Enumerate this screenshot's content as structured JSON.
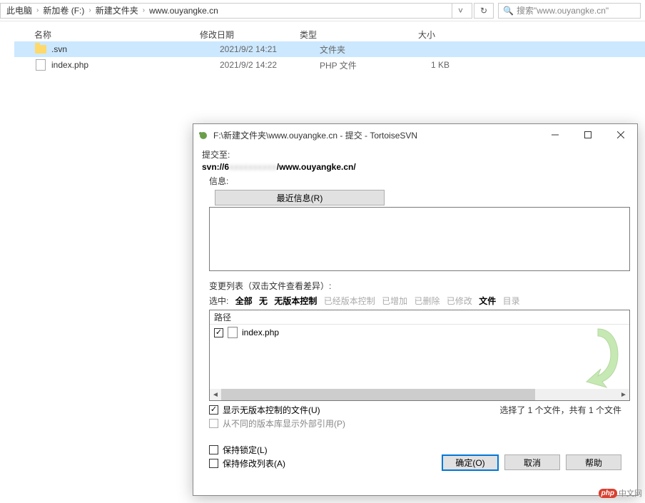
{
  "breadcrumb": {
    "items": [
      "此电脑",
      "新加卷 (F:)",
      "新建文件夹",
      "www.ouyangke.cn"
    ]
  },
  "search": {
    "placeholder": "搜索\"www.ouyangke.cn\""
  },
  "columns": {
    "name": "名称",
    "date": "修改日期",
    "type": "类型",
    "size": "大小"
  },
  "files": [
    {
      "name": ".svn",
      "date": "2021/9/2 14:21",
      "type": "文件夹",
      "size": "",
      "kind": "folder",
      "selected": true
    },
    {
      "name": "index.php",
      "date": "2021/9/2 14:22",
      "type": "PHP 文件",
      "size": "1 KB",
      "kind": "php",
      "selected": false
    }
  ],
  "dialog": {
    "title": "F:\\新建文件夹\\www.ouyangke.cn - 提交 - TortoiseSVN",
    "commit_to_label": "提交至:",
    "svn_prefix": "svn://6",
    "svn_suffix": "/www.ouyangke.cn/",
    "info_label": "信息:",
    "recent_btn": "最近信息(R)",
    "changes_label": "变更列表（双击文件查看差异）:",
    "filters": {
      "label": "选中:",
      "all": "全部",
      "none": "无",
      "unversioned": "无版本控制",
      "versioned": "已经版本控制",
      "added": "已增加",
      "deleted": "已删除",
      "modified": "已修改",
      "files": "文件",
      "dirs": "目录"
    },
    "path_header": "路径",
    "change_items": [
      {
        "name": "index.php",
        "checked": true
      }
    ],
    "show_unversioned": "显示无版本控制的文件(U)",
    "show_externals": "从不同的版本库显示外部引用(P)",
    "selection_status": "选择了 1 个文件，共有 1 个文件",
    "keep_lock": "保持锁定(L)",
    "keep_changelist": "保持修改列表(A)",
    "ok": "确定(O)",
    "cancel": "取消",
    "help": "帮助"
  },
  "watermark": {
    "badge": "php",
    "text": "中文网"
  }
}
